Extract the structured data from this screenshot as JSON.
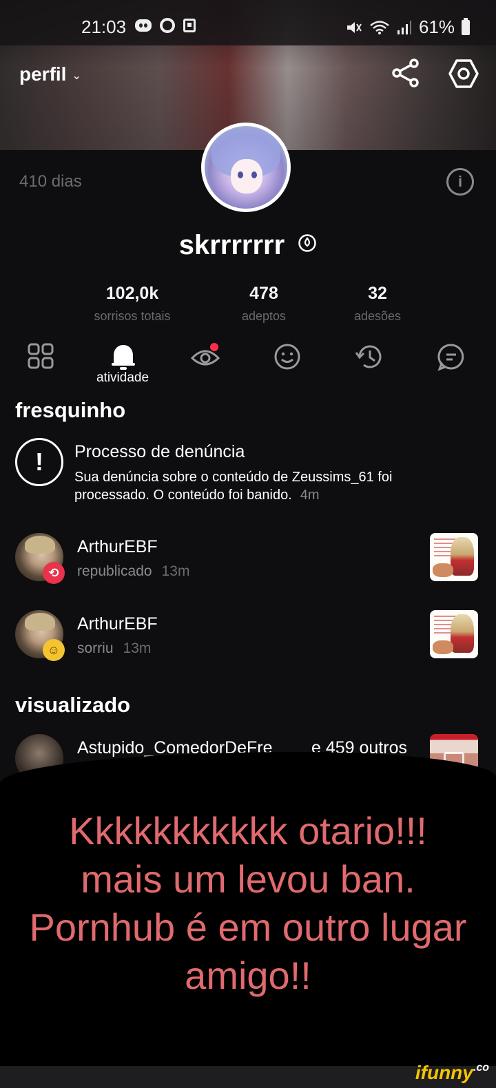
{
  "status_bar": {
    "time": "21:03",
    "battery": "61%",
    "icons_left": [
      "discord-icon",
      "shazam-icon",
      "gallery-icon"
    ],
    "icons_right": [
      "mute-icon",
      "wifi-icon",
      "signal-icon",
      "battery-icon"
    ]
  },
  "header": {
    "title": "perfil",
    "chevron": "⌄",
    "actions": [
      "share-icon",
      "settings-icon"
    ]
  },
  "profile": {
    "days": "410 dias",
    "username": "skrrrrrrr",
    "stats": [
      {
        "value": "102,0k",
        "label": "sorrisos totais"
      },
      {
        "value": "478",
        "label": "adeptos"
      },
      {
        "value": "32",
        "label": "adesões"
      }
    ]
  },
  "tabs": {
    "items": [
      "grid-icon",
      "bell-icon",
      "eye-icon",
      "smile-icon",
      "history-icon",
      "chat-icon"
    ],
    "active_label": "atividade",
    "badge_color": "#ff2d4a"
  },
  "sections": {
    "fresh": "fresquinho",
    "viewed": "visualizado"
  },
  "report_notification": {
    "icon": "!",
    "title": "Processo de denúncia",
    "body": "Sua denúncia sobre o conteúdo de Zeussims_61 foi processado. O conteúdo foi banido.",
    "time": "4m"
  },
  "activity": [
    {
      "user": "ArthurEBF",
      "action": "republicado",
      "time": "13m",
      "badge": "repost-icon",
      "badge_glyph": "⟲"
    },
    {
      "user": "ArthurEBF",
      "action": "sorriu",
      "time": "13m",
      "badge": "smile-icon",
      "badge_glyph": "☺"
    }
  ],
  "viewed_row": {
    "user": "Astupido_ComedorDeFre",
    "others": "e 459 outros"
  },
  "overlay": {
    "lines": [
      "Kkkkkkkkkkk otario!!!",
      "mais um levou ban.",
      "Pornhub é em outro lugar",
      "amigo!!"
    ],
    "color": "#e06a6e"
  },
  "watermark": {
    "text": "ifunny",
    "suffix": ".co"
  }
}
